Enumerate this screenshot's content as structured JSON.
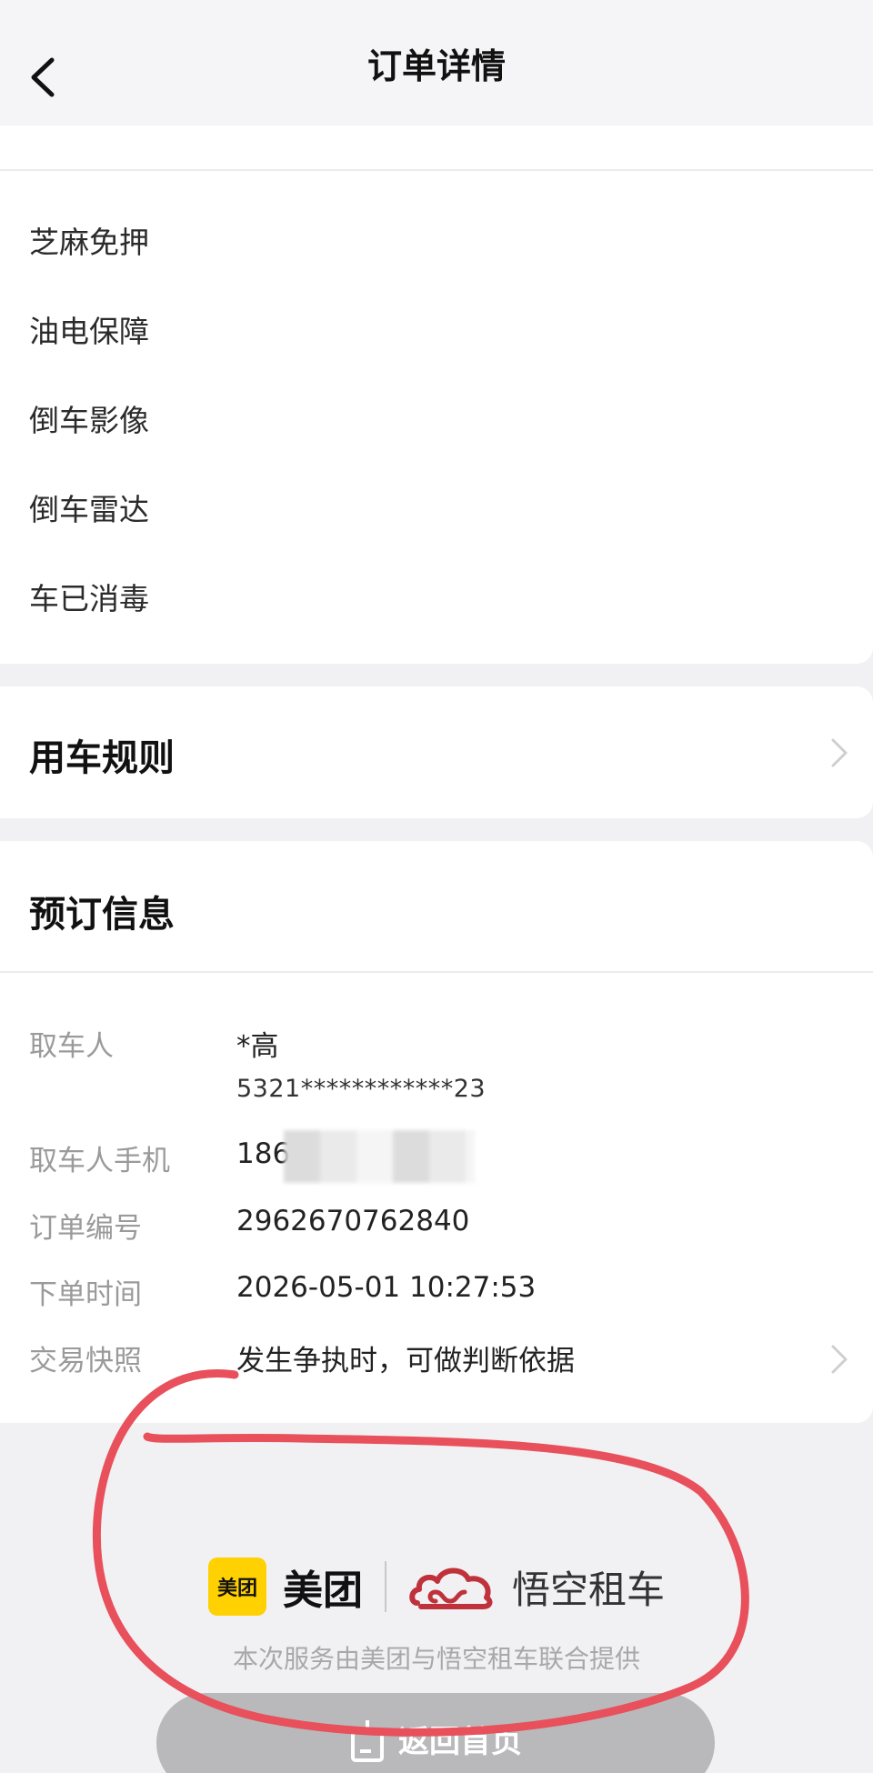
{
  "header": {
    "title": "订单详情"
  },
  "features": [
    "芝麻免押",
    "油电保障",
    "倒车影像",
    "倒车雷达",
    "车已消毒"
  ],
  "rules": {
    "title": "用车规则"
  },
  "booking": {
    "title": "预订信息",
    "pickup_person": {
      "label": "取车人",
      "value": "*高",
      "id_number": "5321************23"
    },
    "phone": {
      "label": "取车人手机",
      "value": "186"
    },
    "order_no": {
      "label": "订单编号",
      "value": "2962670762840"
    },
    "order_time": {
      "label": "下单时间",
      "value": "2026-05-01 10:27:53"
    },
    "snapshot": {
      "label": "交易快照",
      "value": "发生争执时，可做判断依据"
    }
  },
  "footer": {
    "meituan_badge": "美团",
    "meituan_text": "美团",
    "partner_text": "悟空租车",
    "note": "本次服务由美团与悟空租车联合提供",
    "home_button": "返回首页"
  },
  "colors": {
    "annotation": "#e8505b",
    "meituan_yellow": "#ffd100",
    "partner_red": "#c0323b"
  }
}
